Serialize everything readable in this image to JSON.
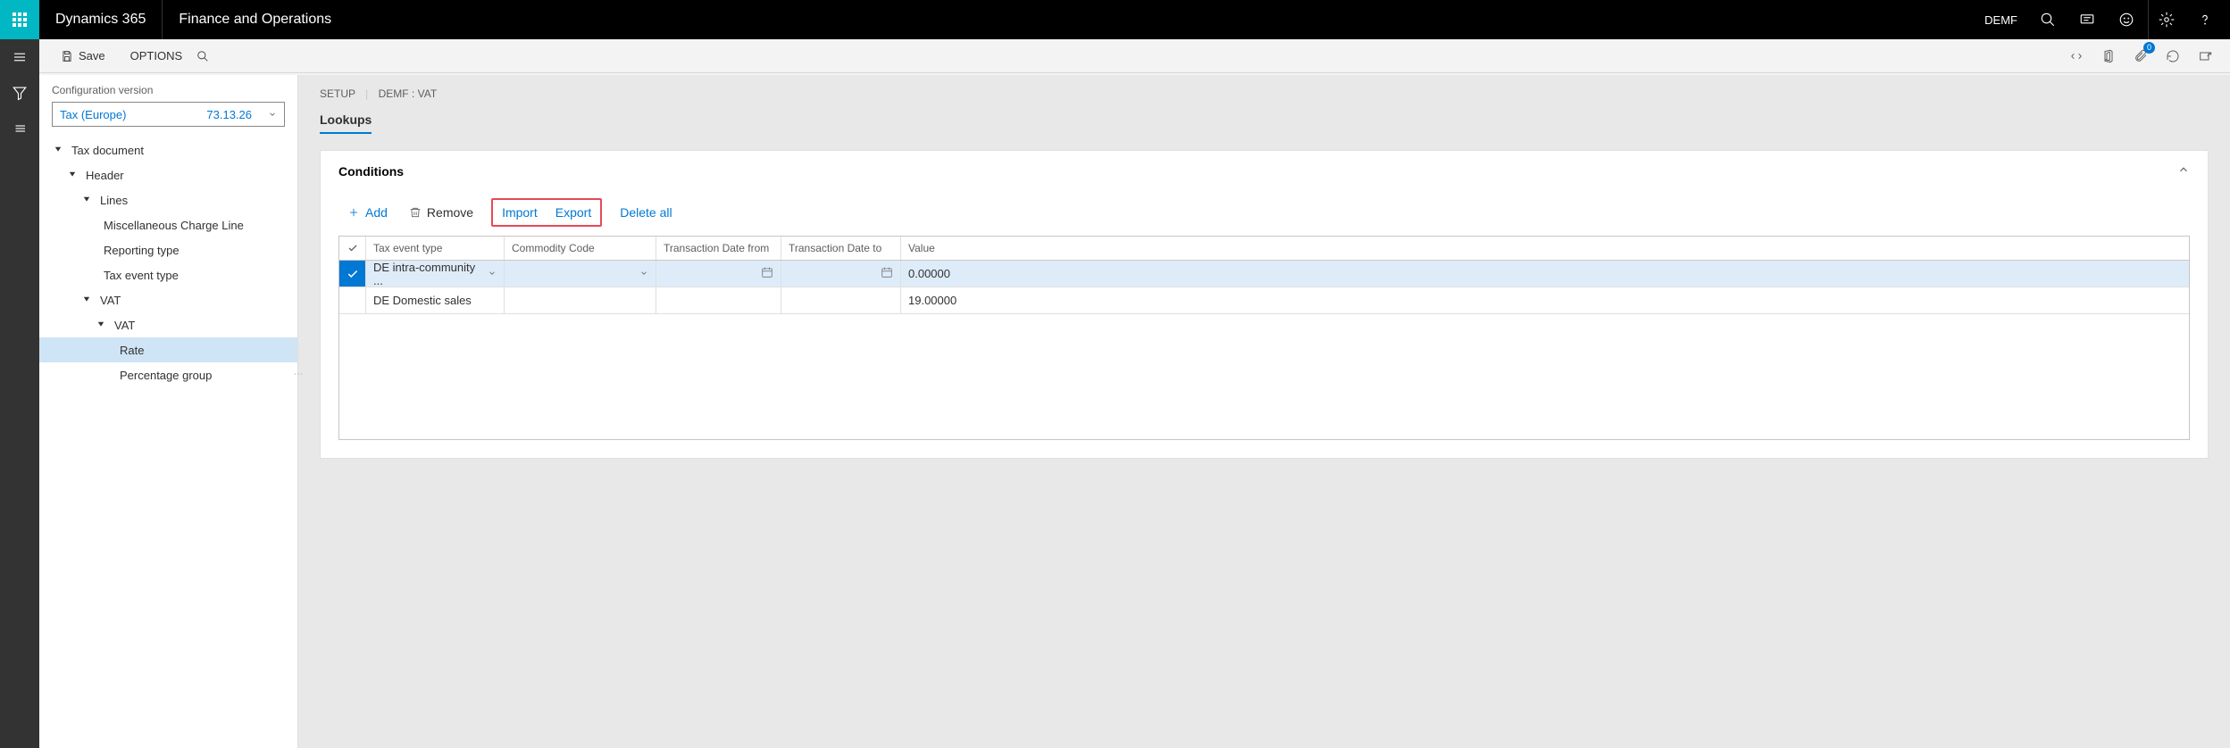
{
  "header": {
    "brand": "Dynamics 365",
    "subtitle": "Finance and Operations",
    "company": "DEMF"
  },
  "actionbar": {
    "save": "Save",
    "options": "OPTIONS",
    "badge": "0"
  },
  "sidebar": {
    "config_label": "Configuration version",
    "config_name": "Tax (Europe)",
    "config_version": "73.13.26",
    "tree": {
      "n0": "Tax document",
      "n1": "Header",
      "n2": "Lines",
      "n3": "Miscellaneous Charge Line",
      "n4": "Reporting type",
      "n5": "Tax event type",
      "n6": "VAT",
      "n7": "VAT",
      "n8": "Rate",
      "n9": "Percentage group"
    }
  },
  "content": {
    "crumb1": "SETUP",
    "crumb2": "DEMF : VAT",
    "tab": "Lookups",
    "panel_title": "Conditions",
    "toolbar": {
      "add": "Add",
      "remove": "Remove",
      "import": "Import",
      "export": "Export",
      "delete_all": "Delete all"
    },
    "grid": {
      "h1": "Tax event type",
      "h2": "Commodity Code",
      "h3": "Transaction Date from",
      "h4": "Transaction Date to",
      "h5": "Value",
      "rows": [
        {
          "tax_event": "DE intra-community ...",
          "commodity": "",
          "date_from": "",
          "date_to": "",
          "value": "0.00000"
        },
        {
          "tax_event": "DE Domestic sales",
          "commodity": "",
          "date_from": "",
          "date_to": "",
          "value": "19.00000"
        }
      ]
    }
  }
}
